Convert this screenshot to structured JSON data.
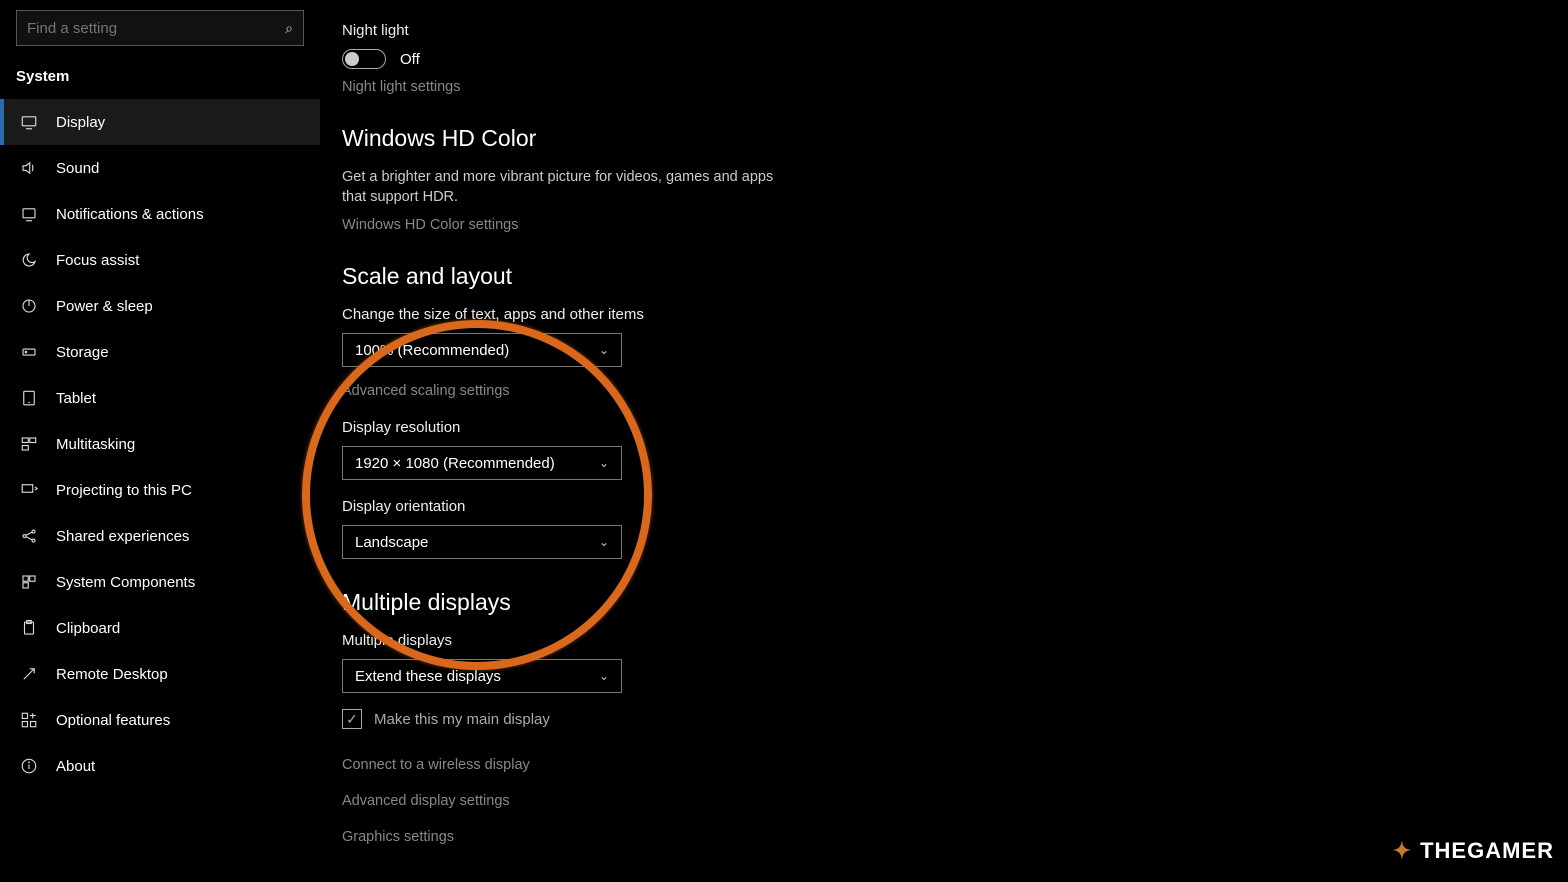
{
  "search": {
    "placeholder": "Find a setting"
  },
  "category": "System",
  "nav": [
    {
      "label": "Display"
    },
    {
      "label": "Sound"
    },
    {
      "label": "Notifications & actions"
    },
    {
      "label": "Focus assist"
    },
    {
      "label": "Power & sleep"
    },
    {
      "label": "Storage"
    },
    {
      "label": "Tablet"
    },
    {
      "label": "Multitasking"
    },
    {
      "label": "Projecting to this PC"
    },
    {
      "label": "Shared experiences"
    },
    {
      "label": "System Components"
    },
    {
      "label": "Clipboard"
    },
    {
      "label": "Remote Desktop"
    },
    {
      "label": "Optional features"
    },
    {
      "label": "About"
    }
  ],
  "nightlight": {
    "title": "Night light",
    "state": "Off",
    "link": "Night light settings"
  },
  "hdcolor": {
    "title": "Windows HD Color",
    "desc": "Get a brighter and more vibrant picture for videos, games and apps that support HDR.",
    "link": "Windows HD Color settings"
  },
  "scale": {
    "title": "Scale and layout",
    "change_label": "Change the size of text, apps and other items",
    "scale_value": "100% (Recommended)",
    "adv_link": "Advanced scaling settings",
    "res_label": "Display resolution",
    "res_value": "1920 × 1080 (Recommended)",
    "orient_label": "Display orientation",
    "orient_value": "Landscape"
  },
  "multi": {
    "title": "Multiple displays",
    "label": "Multiple displays",
    "value": "Extend these displays",
    "checkbox": "Make this my main display",
    "connect": "Connect to a wireless display",
    "adv": "Advanced display settings",
    "graphics": "Graphics settings"
  },
  "watermark": "THEGAMER"
}
